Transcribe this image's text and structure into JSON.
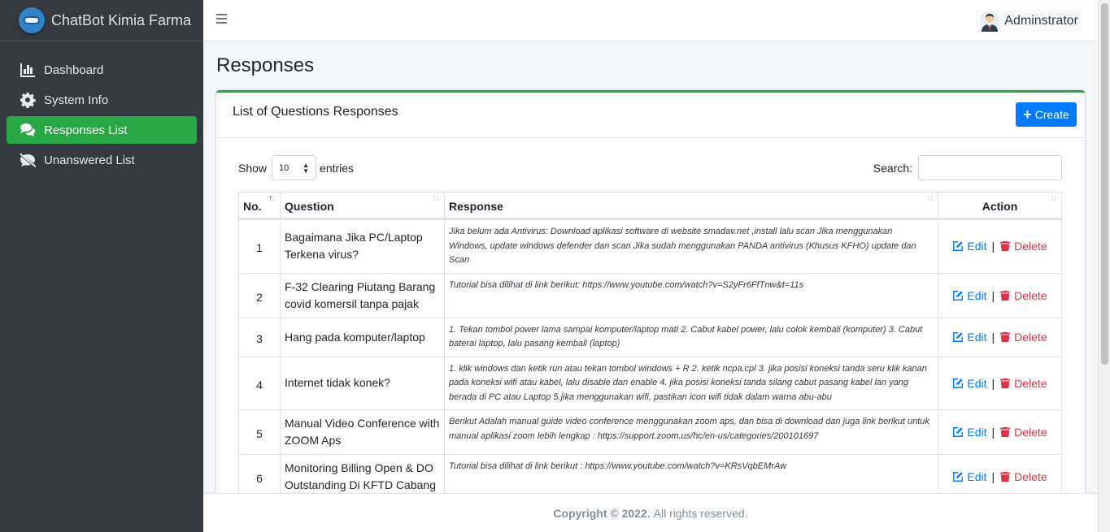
{
  "brand": {
    "name": "ChatBot Kimia Farma"
  },
  "sidebar": {
    "items": [
      {
        "label": "Dashboard",
        "icon": "bar-chart-icon"
      },
      {
        "label": "System Info",
        "icon": "gear-icon"
      },
      {
        "label": "Responses List",
        "icon": "comments-icon",
        "active": true
      },
      {
        "label": "Unanswered List",
        "icon": "comment-slash-icon"
      }
    ]
  },
  "topbar": {
    "user_name": "Adminstrator"
  },
  "page": {
    "title": "Responses"
  },
  "card": {
    "title": "List of Questions Responses",
    "create_label": "Create",
    "show_label": "Show",
    "entries_value": "10",
    "entries_label": "entries",
    "search_label": "Search:",
    "search_value": ""
  },
  "table": {
    "columns": [
      "No.",
      "Question",
      "Response",
      "Action"
    ],
    "edit_label": "Edit",
    "delete_label": "Delete",
    "rows": [
      {
        "no": "1",
        "question": "Bagaimana Jika PC/Laptop Terkena virus?",
        "response": "Jika belum ada Antivirus: Download aplikasi software di website smadav.net ,install lalu scan Jika menggunakan Windows, update windows defender dan scan Jika sudah menggunakan PANDA antivirus (Khusus KFHO) update dan Scan"
      },
      {
        "no": "2",
        "question": "F-32 Clearing Piutang Barang covid komersil tanpa pajak",
        "response": "Tutorial bisa dilihat di link berikut: https://www.youtube.com/watch?v=S2yFr6FfTnw&t=11s"
      },
      {
        "no": "3",
        "question": "Hang pada komputer/laptop",
        "response": "1. Tekan tombol power lama sampai komputer/laptop mati 2. Cabut kabel power, lalu colok kembali (komputer) 3. Cabut baterai laptop, lalu pasang kembali (laptop)"
      },
      {
        "no": "4",
        "question": "Internet tidak konek?",
        "response": "1. klik windows dan ketik run atau tekan tombol windows + R 2. ketik ncpa.cpl 3. jika posisi koneksi tanda seru klik kanan pada koneksi wifi atau kabel, lalu disable dan enable 4. jika posisi koneksi tanda silang cabut pasang kabel lan yang berada di PC atau Laptop 5.jika menggunakan wifi, pastikan icon wifi tidak dalam warna abu-abu"
      },
      {
        "no": "5",
        "question": "Manual Video Conference with ZOOM Aps",
        "response": "Berikut Adalah manual guide video conference menggunakan zoom aps, dan bisa di download dan juga link berikut untuk manual aplikasi zoom lebih lengkap : https://support.zoom.us/hc/en-us/categories/200101697"
      },
      {
        "no": "6",
        "question": "Monitoring Billing Open & DO Outstanding Di KFTD Cabang",
        "response": "Tutorial bisa dilihat di link berikut : https://www.youtube.com/watch?v=KRsVqbEMrAw"
      }
    ]
  },
  "footer": {
    "copyright": "Copyright © 2022.",
    "rights": "All rights reserved."
  },
  "colors": {
    "sidebar": "#343a40",
    "active": "#28a745",
    "primary": "#007bff",
    "danger": "#dc3545"
  }
}
